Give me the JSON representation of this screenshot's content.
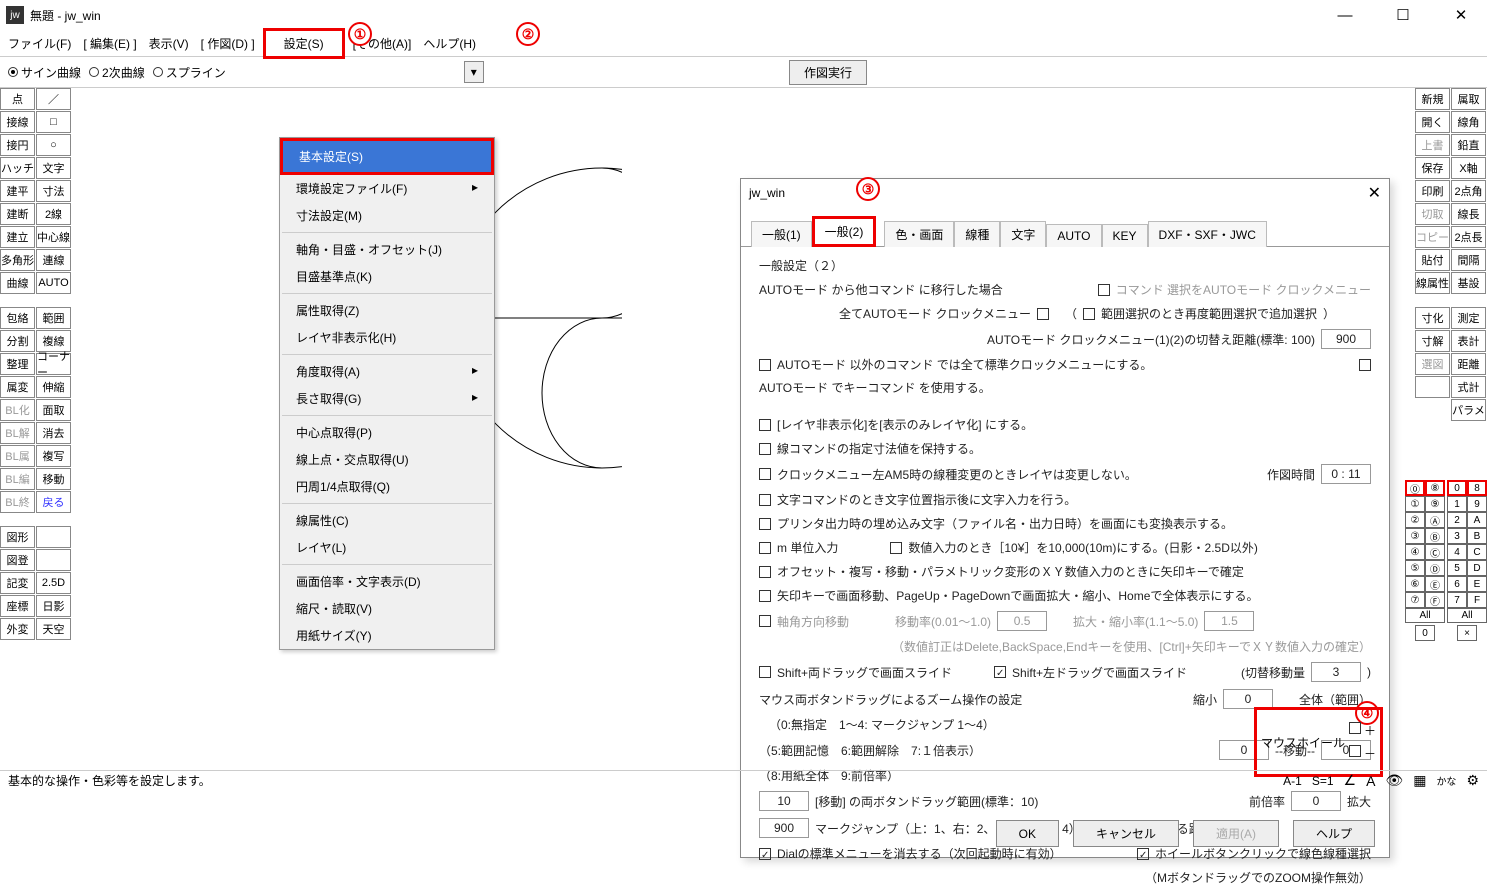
{
  "title": "無題 - jw_win",
  "menubar": [
    "ファイル(F)",
    "[ 編集(E) ]",
    "表示(V)",
    "[ 作図(D) ]",
    "設定(S)",
    "[その他(A)]",
    "ヘルプ(H)"
  ],
  "subbar": {
    "opts": [
      "サイン曲線",
      "2次曲線",
      "スプライン"
    ],
    "exec": "作図実行"
  },
  "left1": [
    "点",
    "接線",
    "接円",
    "ハッチ",
    "建平",
    "建断",
    "建立",
    "多角形",
    "曲線"
  ],
  "left2": [
    "／",
    "□",
    "○",
    "文字",
    "寸法",
    "2線",
    "中心線",
    "連線",
    "AUTO"
  ],
  "leftA": [
    "包絡",
    "分割",
    "整理",
    "属変",
    "BL化",
    "BL解",
    "BL属",
    "BL編",
    "BL終"
  ],
  "leftB": [
    "範囲",
    "複線",
    "コーナー",
    "伸縮",
    "面取",
    "消去",
    "複写",
    "移動",
    "戻る"
  ],
  "leftC": [
    "図形",
    "図登",
    "記変",
    "座標",
    "外変"
  ],
  "leftD": [
    "",
    "",
    "2.5D",
    "日影",
    "天空"
  ],
  "right1": [
    "新規",
    "開く",
    "上書",
    "保存",
    "印刷",
    "切取",
    "コピー",
    "貼付",
    "線属性"
  ],
  "right2": [
    "属取",
    "線角",
    "鉛直",
    "X軸",
    "2点角",
    "線長",
    "2点長",
    "間隔",
    "基設"
  ],
  "rightA": [
    "寸化",
    "寸解",
    "選図",
    ""
  ],
  "rightB": [
    "測定",
    "表計",
    "距離",
    "式計",
    "パラメ"
  ],
  "gridL": [
    "⓪",
    "①",
    "②",
    "③",
    "④",
    "⑤",
    "⑥",
    "⑦"
  ],
  "gridR": [
    "⑧",
    "⑨",
    "Ⓐ",
    "Ⓑ",
    "Ⓒ",
    "Ⓓ",
    "Ⓔ",
    "Ⓕ"
  ],
  "gridL2": [
    "0",
    "1",
    "2",
    "3",
    "4",
    "5",
    "6",
    "7"
  ],
  "gridR2": [
    "8",
    "9",
    "A",
    "B",
    "C",
    "D",
    "E",
    "F"
  ],
  "all": "All",
  "dropdown": [
    {
      "t": "基本設定(S)",
      "sel": true
    },
    {
      "t": "環境設定ファイル(F)",
      "sub": true
    },
    {
      "t": "寸法設定(M)"
    },
    {
      "sep": true
    },
    {
      "t": "軸角・目盛・オフセット(J)"
    },
    {
      "t": "目盛基準点(K)"
    },
    {
      "sep": true
    },
    {
      "t": "属性取得(Z)"
    },
    {
      "t": "レイヤ非表示化(H)"
    },
    {
      "sep": true
    },
    {
      "t": "角度取得(A)",
      "sub": true
    },
    {
      "t": "長さ取得(G)",
      "sub": true
    },
    {
      "sep": true
    },
    {
      "t": "中心点取得(P)"
    },
    {
      "t": "線上点・交点取得(U)"
    },
    {
      "t": "円周1/4点取得(Q)"
    },
    {
      "sep": true
    },
    {
      "t": "線属性(C)"
    },
    {
      "t": "レイヤ(L)"
    },
    {
      "sep": true
    },
    {
      "t": "画面倍率・文字表示(D)"
    },
    {
      "t": "縮尺・読取(V)"
    },
    {
      "t": "用紙サイズ(Y)"
    }
  ],
  "dlg": {
    "title": "jw_win",
    "tabs": [
      "一般(1)",
      "一般(2)",
      "色・画面",
      "線種",
      "文字",
      "AUTO",
      "KEY",
      "DXF・SXF・JWC"
    ],
    "heading": "一般設定（２）",
    "l1": "AUTOモード から他コマンド に移行した場合",
    "l1a": "コマンド 選択をAUTOモード クロックメニュー",
    "l2": "全てAUTOモード クロックメニュー",
    "l2a": "範囲選択のとき再度範囲選択で追加選択",
    "l3": "AUTOモード クロックメニュー(1)(2)の切替え距離(標準: 100)",
    "v3": "900",
    "l4": "AUTOモード 以外のコマンド では全て標準クロックメニューにする。",
    "l4a": "AUTOモード でキーコマンド を使用する。",
    "l5": "[レイヤ非表示化]を[表示のみレイヤ化] にする。",
    "l6": "線コマンドの指定寸法値を保持する。",
    "l7": "クロックメニュー左AM5時の線種変更のときレイヤは変更しない。",
    "l7l": "作図時間",
    "l7v": "0 : 11",
    "l8": "文字コマンドのとき文字位置指示後に文字入力を行う。",
    "l9": "プリンタ出力時の埋め込み文字（ファイル名・出力日時）を画面にも変換表示する。",
    "l10": "m 単位入力",
    "l10a": "数値入力のとき［10¥］を10,000(10m)にする。(日影・2.5D以外)",
    "l11": "オフセット・複写・移動・パラメトリック変形のＸＹ数値入力のときに矢印キーで確定",
    "l12": "矢印キーで画面移動、PageUp・PageDownで画面拡大・縮小、Homeで全体表示にする。",
    "l13": "軸角方向移動",
    "l13a": "移動率(0.01～1.0)",
    "v13a": "0.5",
    "l13b": "拡大・縮小率(1.1～5.0)",
    "v13b": "1.5",
    "l14": "（数値訂正はDelete,BackSpace,Endキーを使用、[Ctrl]+矢印キーでＸＹ数値入力の確定）",
    "l15": "Shift+両ドラッグで画面スライド",
    "l15a": "Shift+左ドラッグで画面スライド",
    "l15l": "(切替移動量",
    "v15": "3",
    "l16": "マウス両ボタンドラッグによるズーム操作の設定",
    "l16a": "縮小",
    "v16a": "0",
    "l16b": "全体（範囲）",
    "l17": "（0:無指定　1～4: マークジャンプ 1～4）",
    "l18": "（5:範囲記憶　6:範囲解除　7:１倍表示）",
    "v18a": "0",
    "l18m": "--移動--",
    "v18b": "0",
    "l19": "（8:用紙全体　9:前倍率）",
    "v20": "10",
    "l20": "[移動] の両ボタンドラッグ範囲(標準：10)",
    "l20a": "前倍率",
    "v20a": "0",
    "l20b": "拡大",
    "v21": "900",
    "l21": "マークジャンプ（上：1、右：2、下：3、左：4）へ強制的に移行する距離(標準：100)",
    "l22": "Dialの標準メニューを消去する（次回起動時に有効）",
    "l22a": "ホイールボタンクリックで線色線種選択",
    "l23": "（MボタンドラッグでのZOOM操作無効）",
    "mw": "マウスホイール",
    "btns": [
      "OK",
      "キャンセル",
      "適用(A)",
      "ヘルプ"
    ]
  },
  "callouts": {
    "c1": "①",
    "c2": "②",
    "c3": "③",
    "c4": "④"
  },
  "status": {
    "l": "基本的な操作・色彩等を設定します。",
    "r1": "A-1",
    "r2": "S=1"
  }
}
